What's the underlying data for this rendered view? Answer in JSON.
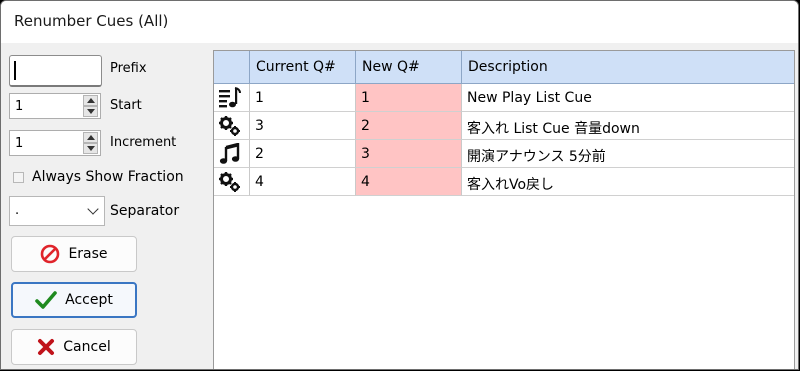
{
  "window": {
    "title": "Renumber Cues (All)"
  },
  "left_panel": {
    "prefix": {
      "value": "",
      "label": "Prefix"
    },
    "start": {
      "value": "1",
      "label": "Start"
    },
    "increment": {
      "value": "1",
      "label": "Increment"
    },
    "always_show_fraction": {
      "label": "Always Show Fraction",
      "checked": false
    },
    "separator": {
      "value": ".",
      "label": "Separator"
    },
    "buttons": {
      "erase": "Erase",
      "accept": "Accept",
      "cancel": "Cancel"
    }
  },
  "grid": {
    "columns": [
      "Current Q#",
      "New Q#",
      "Description"
    ],
    "rows": [
      {
        "icon": "playlist-icon",
        "current": "1",
        "new": "1",
        "description": "New Play List Cue"
      },
      {
        "icon": "gears-icon",
        "current": "3",
        "new": "2",
        "description": "客入れ List  Cue  音量down"
      },
      {
        "icon": "music-note-icon",
        "current": "2",
        "new": "3",
        "description": "開演アナウンス  5分前"
      },
      {
        "icon": "gears-icon",
        "current": "4",
        "new": "4",
        "description": "客入れVo戻し"
      }
    ]
  },
  "colors": {
    "header_bg": "#cfe0f7",
    "new_q_bg": "#ffc4c4",
    "accent": "#3a76c3"
  }
}
